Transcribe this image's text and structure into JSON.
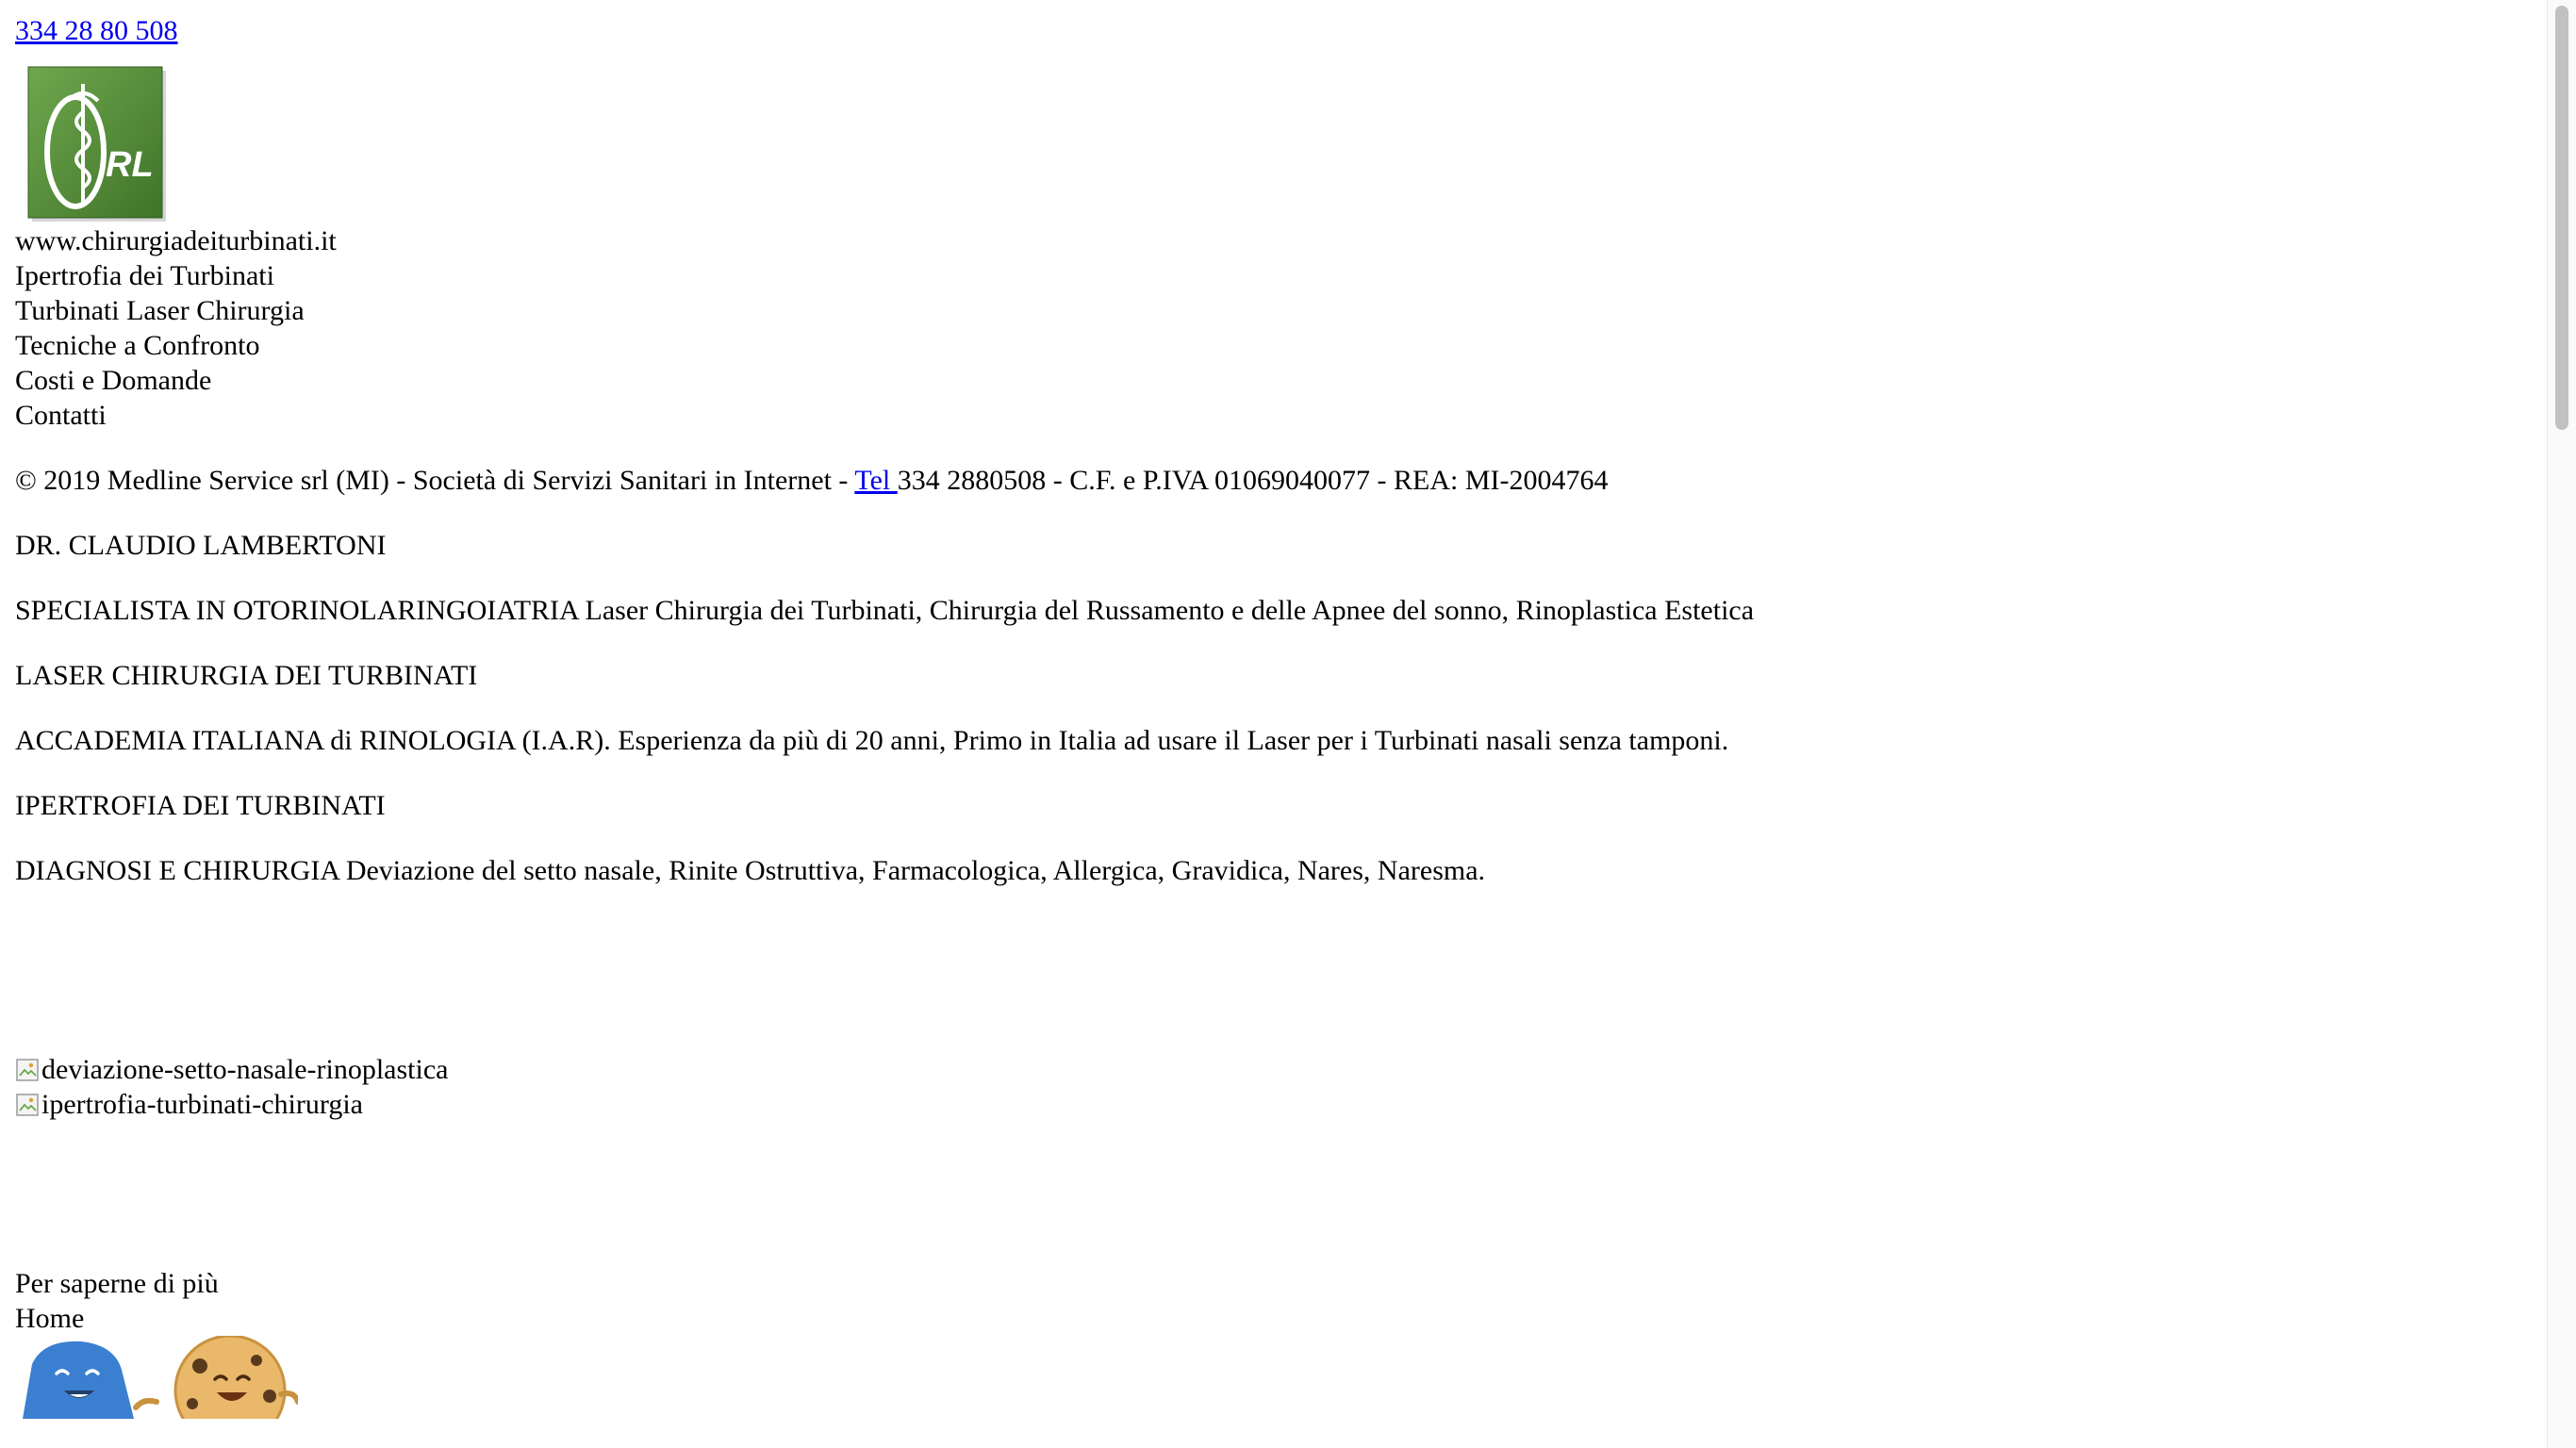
{
  "header": {
    "phone_link": "334 28 80 508",
    "logo_letters": "RL"
  },
  "site": {
    "domain": "www.chirurgiadeiturbinati.it"
  },
  "menu": {
    "items": [
      "Ipertrofia dei Turbinati",
      "Turbinati Laser Chirurgia",
      "Tecniche a Confronto",
      "Costi e Domande",
      "Contatti"
    ]
  },
  "footer_line": {
    "before": "© 2019 Medline Service srl (MI) - Società di Servizi Sanitari in Internet - ",
    "tel_link": "Tel ",
    "after": "334 2880508 - C.F. e P.IVA 01069040077 - REA: MI-2004764"
  },
  "content": {
    "doctor": "DR. CLAUDIO LAMBERTONI",
    "specialist": "SPECIALISTA IN OTORINOLARINGOIATRIA Laser Chirurgia dei Turbinati, Chirurgia del Russamento e delle Apnee del sonno, Rinoplastica Estetica",
    "laser_title": "LASER CHIRURGIA DEI TURBINATI",
    "academy": "ACCADEMIA ITALIANA di RINOLOGIA (I.A.R). Esperienza da più di 20 anni, Primo in Italia ad usare il Laser per i Turbinati nasali senza tamponi.",
    "hypertrophy_title": "IPERTROFIA DEI TURBINATI",
    "diagnosis": "DIAGNOSI E CHIRURGIA Deviazione del setto nasale, Rinite Ostruttiva, Farmacologica, Allergica, Gravidica, Nares, Naresma."
  },
  "images": {
    "alt1": "deviazione-setto-nasale-rinoplastica",
    "alt2": "ipertrofia-turbinati-chirurgia"
  },
  "bottom": {
    "more": "Per saperne di più",
    "home": "Home"
  },
  "colors": {
    "link": "#0000ee",
    "logo_green": "#4f8a35",
    "text": "#000000"
  }
}
